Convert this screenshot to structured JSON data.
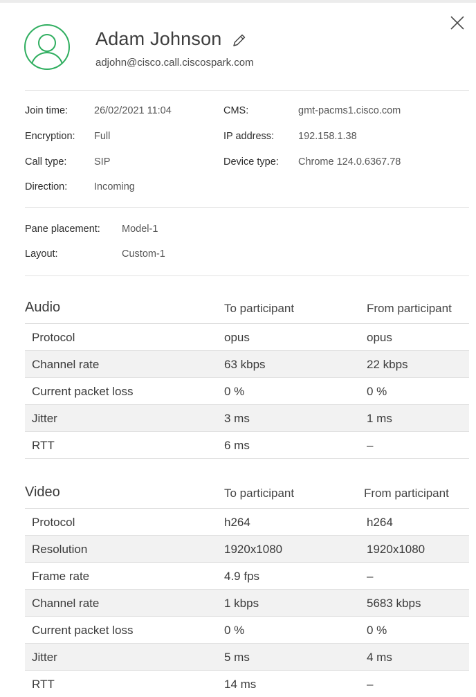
{
  "user": {
    "name": "Adam Johnson",
    "email": "adjohn@cisco.call.ciscospark.com"
  },
  "details_left": [
    {
      "label": "Join time:",
      "value": "26/02/2021 11:04"
    },
    {
      "label": "Encryption:",
      "value": "Full"
    },
    {
      "label": "Call type:",
      "value": "SIP"
    },
    {
      "label": "Direction:",
      "value": "Incoming"
    }
  ],
  "details_right": [
    {
      "label": "CMS:",
      "value": "gmt-pacms1.cisco.com"
    },
    {
      "label": "IP address:",
      "value": "192.158.1.38"
    },
    {
      "label": "Device type:",
      "value": "Chrome 124.0.6367.78"
    }
  ],
  "placement": [
    {
      "label": "Pane placement:",
      "value": "Model-1"
    },
    {
      "label": "Layout:",
      "value": "Custom-1"
    }
  ],
  "audio": {
    "title": "Audio",
    "col_to": "To participant",
    "col_from": "From participant",
    "rows": [
      {
        "metric": "Protocol",
        "to": "opus",
        "from": "opus"
      },
      {
        "metric": "Channel rate",
        "to": "63 kbps",
        "from": "22 kbps"
      },
      {
        "metric": "Current packet loss",
        "to": "0 %",
        "from": "0 %"
      },
      {
        "metric": "Jitter",
        "to": "3 ms",
        "from": "1 ms"
      },
      {
        "metric": "RTT",
        "to": "6 ms",
        "from": "–"
      }
    ]
  },
  "video": {
    "title": "Video",
    "col_to": "To participant",
    "col_from": "From participant",
    "rows": [
      {
        "metric": "Protocol",
        "to": "h264",
        "from": "h264"
      },
      {
        "metric": "Resolution",
        "to": "1920x1080",
        "from": "1920x1080"
      },
      {
        "metric": "Frame rate",
        "to": "4.9 fps",
        "from": "–"
      },
      {
        "metric": "Channel rate",
        "to": "1 kbps",
        "from": "5683 kbps"
      },
      {
        "metric": "Current packet loss",
        "to": "0 %",
        "from": "0 %"
      },
      {
        "metric": "Jitter",
        "to": "5 ms",
        "from": "4 ms"
      },
      {
        "metric": "RTT",
        "to": "14 ms",
        "from": "–"
      }
    ]
  },
  "colors": {
    "avatar": "#2fae5f",
    "row_shade": "#f2f2f2",
    "divider": "#e3e3e3"
  },
  "icons": {
    "close": "close-icon",
    "edit": "pencil-icon",
    "avatar": "user-avatar-icon"
  }
}
